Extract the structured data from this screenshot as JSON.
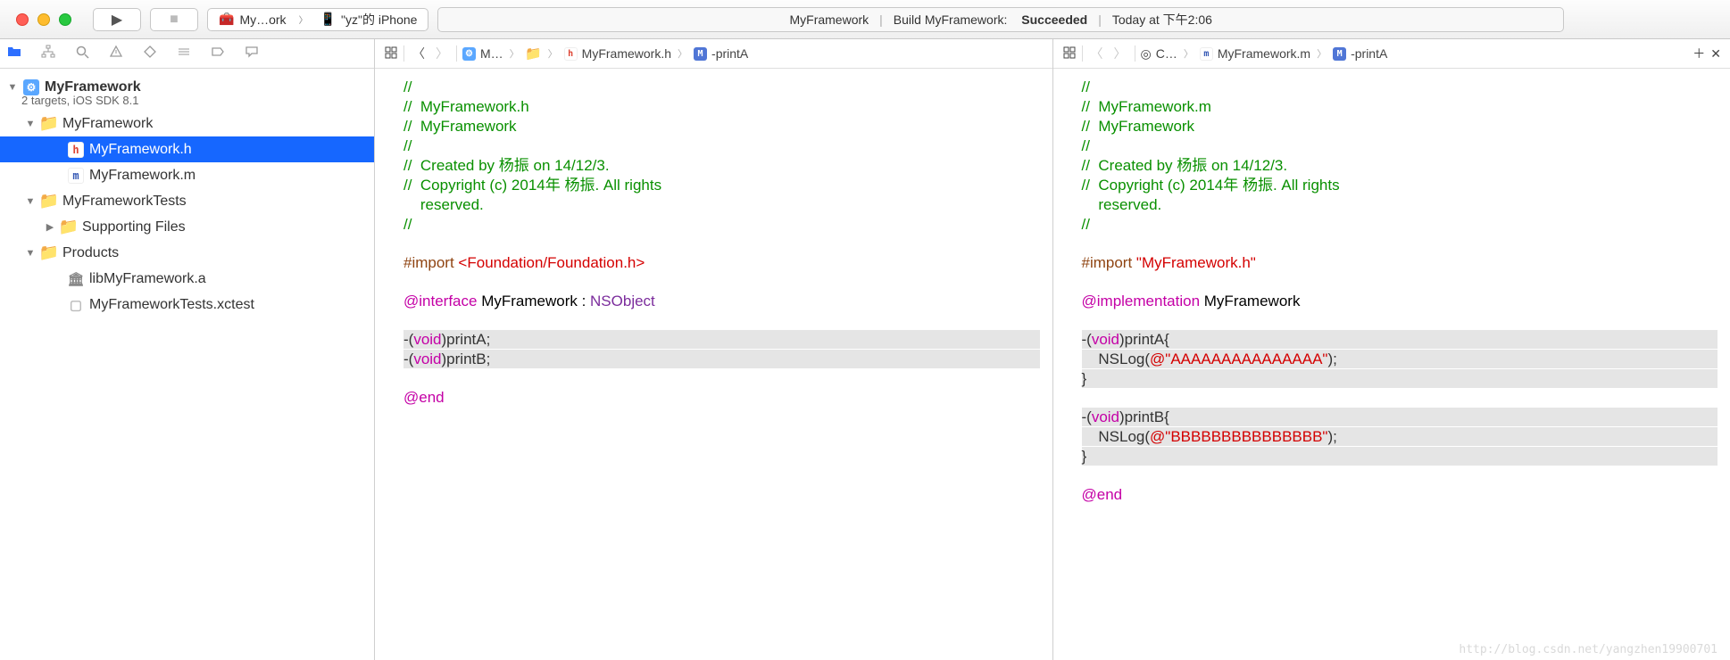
{
  "toolbar": {
    "scheme_name": "My…ork",
    "scheme_device": "\"yz\"的 iPhone",
    "activity_project": "MyFramework",
    "activity_action": "Build MyFramework:",
    "activity_status": "Succeeded",
    "activity_time": "Today at 下午2:06"
  },
  "navigator": {
    "project_name": "MyFramework",
    "project_subtitle": "2 targets, iOS SDK 8.1",
    "group_main": "MyFramework",
    "file_h": "MyFramework.h",
    "file_m": "MyFramework.m",
    "group_tests": "MyFrameworkTests",
    "group_supporting": "Supporting Files",
    "group_products": "Products",
    "product_lib": "libMyFramework.a",
    "product_xctest": "MyFrameworkTests.xctest"
  },
  "editor_left": {
    "jump_proj": "M…",
    "jump_group": "",
    "jump_file": "MyFramework.h",
    "jump_symbol": "-printA",
    "code_comment_1": "//",
    "code_comment_2": "//  MyFramework.h",
    "code_comment_3": "//  MyFramework",
    "code_comment_4": "//",
    "code_comment_5": "//  Created by 杨振 on 14/12/3.",
    "code_comment_6": "//  Copyright (c) 2014年 杨振. All rights",
    "code_comment_7": "    reserved.",
    "code_comment_8": "//",
    "import_kw": "#import ",
    "import_path": "<Foundation/Foundation.h>",
    "iface_kw": "@interface",
    "iface_name": " MyFramework : ",
    "iface_super": "NSObject",
    "m1_a": "-(",
    "m1_b": "void",
    "m1_c": ")printA;",
    "m2_a": "-(",
    "m2_b": "void",
    "m2_c": ")printB;",
    "end_kw": "@end"
  },
  "editor_right": {
    "jump_counter": "C…",
    "jump_file": "MyFramework.m",
    "jump_symbol": "-printA",
    "code_comment_1": "//",
    "code_comment_2": "//  MyFramework.m",
    "code_comment_3": "//  MyFramework",
    "code_comment_4": "//",
    "code_comment_5": "//  Created by 杨振 on 14/12/3.",
    "code_comment_6": "//  Copyright (c) 2014年 杨振. All rights",
    "code_comment_7": "    reserved.",
    "code_comment_8": "//",
    "import_kw": "#import ",
    "import_path": "\"MyFramework.h\"",
    "impl_kw": "@implementation",
    "impl_name": " MyFramework",
    "pA_1a": "-(",
    "pA_1b": "void",
    "pA_1c": ")printA{",
    "pA_2a": "    NSLog(",
    "pA_2b": "@\"AAAAAAAAAAAAAAA\"",
    "pA_2c": ");",
    "pA_3": "}",
    "pB_1a": "-(",
    "pB_1b": "void",
    "pB_1c": ")printB{",
    "pB_2a": "    NSLog(",
    "pB_2b": "@\"BBBBBBBBBBBBBBB\"",
    "pB_2c": ");",
    "pB_3": "}",
    "end_kw": "@end"
  },
  "watermark": "http://blog.csdn.net/yangzhen19900701"
}
